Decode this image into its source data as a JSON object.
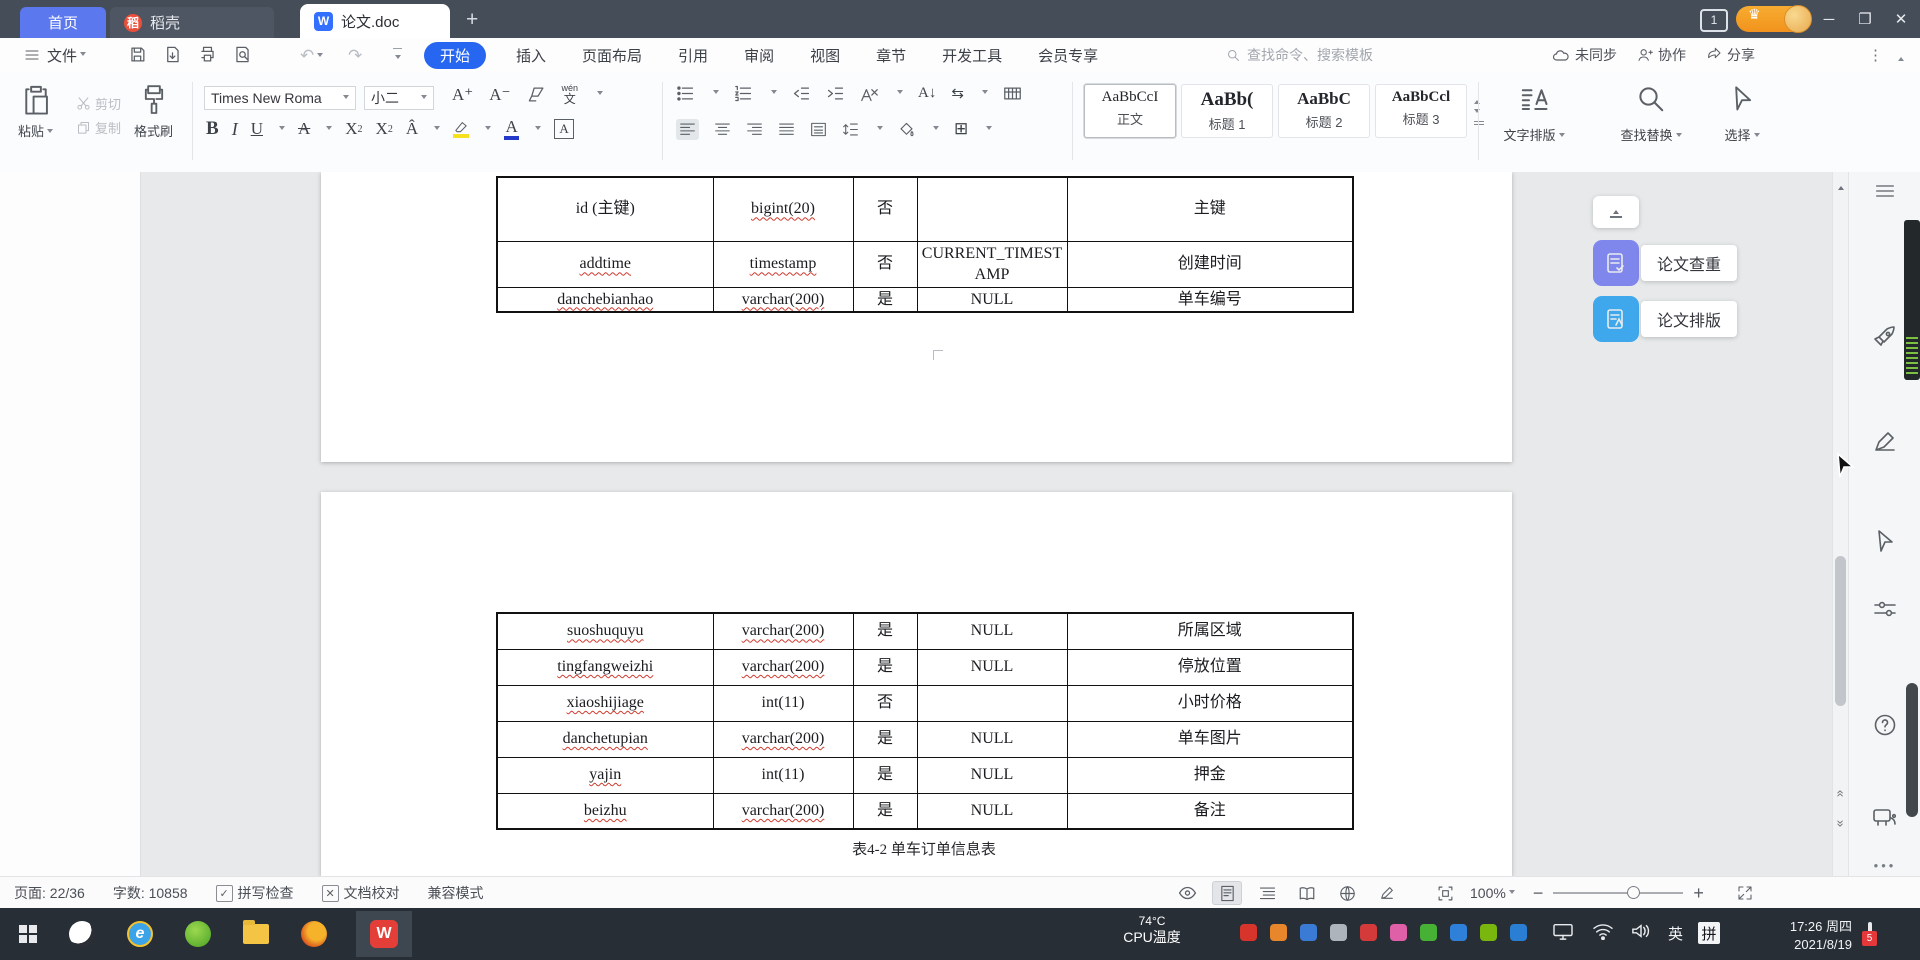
{
  "titlebar": {
    "tabs": [
      {
        "label": "首页"
      },
      {
        "label": "稻壳"
      },
      {
        "label": "论文.doc"
      }
    ],
    "new_tab_icon": "+",
    "window_count": "1"
  },
  "menu": {
    "file_label": "文件",
    "quick_icons": [
      "save-icon",
      "export-pdf-icon",
      "print-icon",
      "print-preview-icon",
      "undo-icon",
      "redo-icon",
      "customize-toolbar-icon"
    ],
    "items": [
      {
        "label": "开始",
        "active": true
      },
      {
        "label": "插入"
      },
      {
        "label": "页面布局"
      },
      {
        "label": "引用"
      },
      {
        "label": "审阅"
      },
      {
        "label": "视图"
      },
      {
        "label": "章节"
      },
      {
        "label": "开发工具"
      },
      {
        "label": "会员专享"
      }
    ],
    "search_placeholder": "查找命令、搜索模板",
    "sync_label": "未同步",
    "collab_label": "协作",
    "share_label": "分享"
  },
  "ribbon": {
    "paste_label": "粘贴",
    "cut_label": "剪切",
    "copy_label": "复制",
    "format_painter_label": "格式刷",
    "font_name": "Times New Roma",
    "font_size": "小二",
    "styles": [
      {
        "sample": "AaBbCcI",
        "name": "正文",
        "selected": true
      },
      {
        "sample": "AaBb(",
        "name": "标题 1"
      },
      {
        "sample": "AaBbC",
        "name": "标题 2"
      },
      {
        "sample": "AaBbCcl",
        "name": "标题 3"
      }
    ],
    "text_layout_label": "文字排版",
    "find_replace_label": "查找替换",
    "select_label": "选择"
  },
  "assistant": {
    "buttons": [
      {
        "label": "论文查重",
        "color": "#8087EC"
      },
      {
        "label": "论文排版",
        "color": "#3FA8EC"
      }
    ]
  },
  "document": {
    "table1": {
      "rows": [
        [
          "id (主键)",
          "bigint(20)",
          "否",
          "",
          "主键"
        ],
        [
          "addtime",
          "timestamp",
          "否",
          "CURRENT_TIMESTAMP",
          "创建时间"
        ],
        [
          "danchebianhao",
          "varchar(200)",
          "是",
          "NULL",
          "单车编号"
        ]
      ]
    },
    "table2": {
      "rows": [
        [
          "suoshuquyu",
          "varchar(200)",
          "是",
          "NULL",
          "所属区域"
        ],
        [
          "tingfangweizhi",
          "varchar(200)",
          "是",
          "NULL",
          "停放位置"
        ],
        [
          "xiaoshijiage",
          "int(11)",
          "否",
          "",
          "小时价格"
        ],
        [
          "danchetupian",
          "varchar(200)",
          "是",
          "NULL",
          "单车图片"
        ],
        [
          "yajin",
          "int(11)",
          "是",
          "NULL",
          "押金"
        ],
        [
          "beizhu",
          "varchar(200)",
          "是",
          "NULL",
          "备注"
        ]
      ],
      "caption": "表4-2 单车订单信息表"
    },
    "misspelled": [
      "addtime",
      "danchebianhao",
      "suoshuquyu",
      "tingfangweizhi",
      "xiaoshijiage",
      "danchetupian",
      "yajin",
      "beizhu",
      "bigint(20)",
      "timestamp",
      "varchar(200)"
    ]
  },
  "status_bar": {
    "page_label": "页面: 22/36",
    "word_count": "字数: 10858",
    "spell_check": "拼写检查",
    "proofread": "文档校对",
    "compatibility": "兼容模式",
    "zoom_value": "100%"
  },
  "taskbar": {
    "cpu_temp": "74°C",
    "cpu_label": "CPU温度",
    "apps": [
      "start-button",
      "sogou-browser-icon",
      "internet-explorer-icon",
      "green-app-icon",
      "file-explorer-icon",
      "firefox-icon",
      "wps-office-active-icon"
    ],
    "tray": [
      {
        "name": "security-red-icon",
        "color": "#D7342C"
      },
      {
        "name": "pc-manager-icon",
        "color": "#E8862B"
      },
      {
        "name": "shield-blue-icon",
        "color": "#3A7BD5"
      },
      {
        "name": "bell-icon",
        "color": "#AEB4BB"
      },
      {
        "name": "qq-red-icon",
        "color": "#D43A3A"
      },
      {
        "name": "qq-pink-icon",
        "color": "#E060A8"
      },
      {
        "name": "wechat-icon",
        "color": "#46B135"
      },
      {
        "name": "tim-blue-icon",
        "color": "#2F80D8"
      },
      {
        "name": "nvidia-icon",
        "color": "#79B60E"
      },
      {
        "name": "bluetooth-icon",
        "color": "#2A7FD4"
      }
    ],
    "language": "英",
    "ime": "拼",
    "time": "17:26 周四",
    "date": "2021/8/19",
    "notification_badge": "5"
  },
  "colors": {
    "accent_blue": "#2666F0",
    "home_tab_blue": "#5B78EE",
    "docer_red": "#E8503C",
    "member_orange": "#F5A11C",
    "badge_red": "#E5383B",
    "taskbar_bg": "#272E36"
  }
}
